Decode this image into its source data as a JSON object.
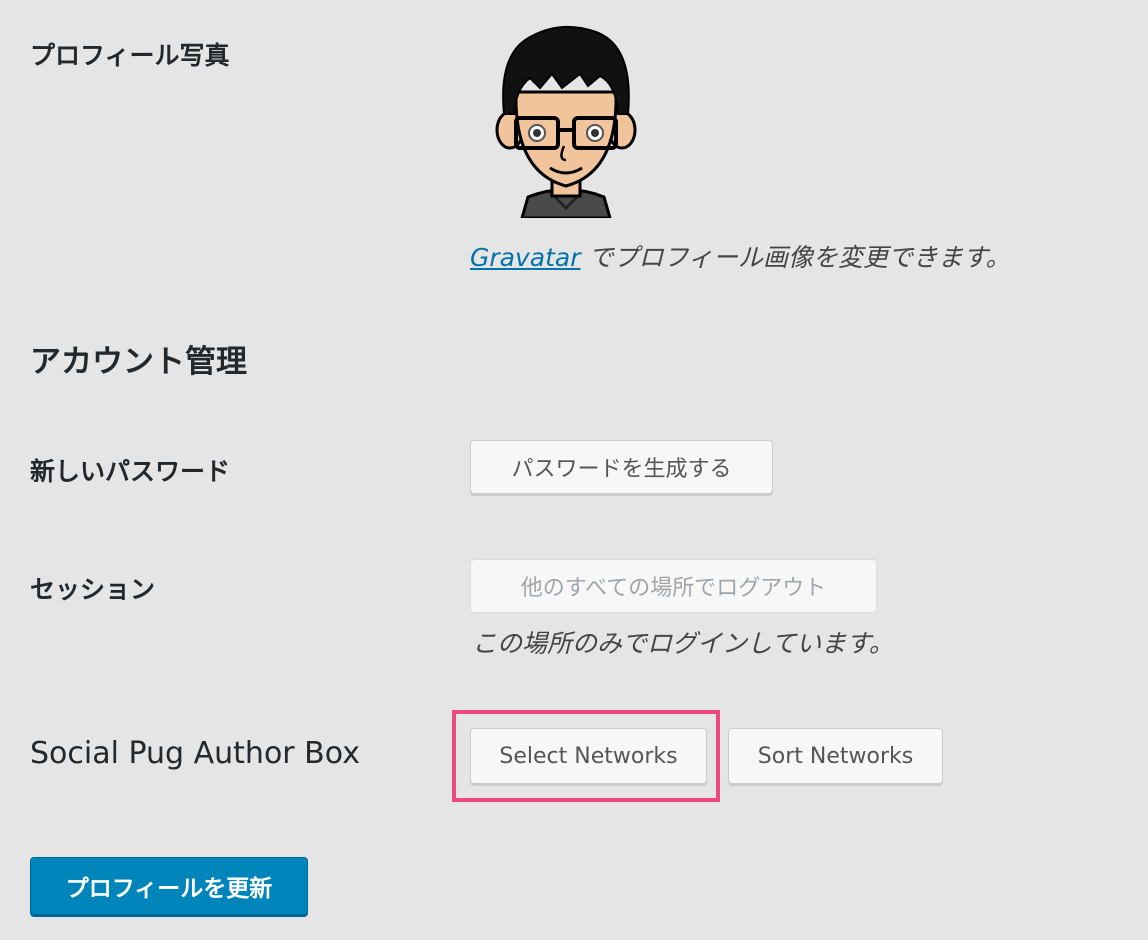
{
  "profile_photo": {
    "label": "プロフィール写真",
    "gravatar_link": "Gravatar",
    "gravatar_note": " でプロフィール画像を変更できます。"
  },
  "account": {
    "section_title": "アカウント管理",
    "new_password_label": "新しいパスワード",
    "generate_password_button": "パスワードを生成する",
    "session_label": "セッション",
    "logout_everywhere_button": "他のすべての場所でログアウト",
    "session_note": "この場所のみでログインしています。"
  },
  "social_pug": {
    "label": "Social Pug Author Box",
    "select_networks_button": "Select Networks",
    "sort_networks_button": "Sort Networks"
  },
  "footer": {
    "update_profile_button": "プロフィールを更新"
  },
  "colors": {
    "background": "#e5e5e5",
    "primary": "#0085ba",
    "link": "#0073aa",
    "highlight": "#ec4a80"
  }
}
